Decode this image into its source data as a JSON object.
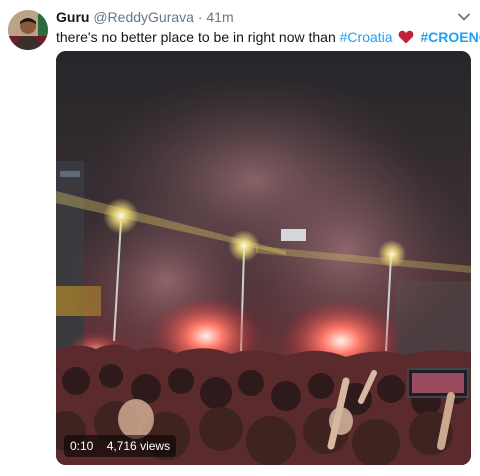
{
  "tweet": {
    "author_name": "Guru",
    "handle": "@ReddyGurava",
    "separator": "·",
    "time": "41m",
    "text_before": "there's no better place to be in right now than",
    "hashtag_1": "#Croatia",
    "hashtag_2": "#CROENG",
    "heart_color": "#c0223b",
    "link_color": "#1da1f2"
  },
  "video": {
    "duration": "0:10",
    "views": "4,716 views"
  },
  "icons": {
    "menu": "chevron-down-icon",
    "reaction": "heart-icon"
  }
}
